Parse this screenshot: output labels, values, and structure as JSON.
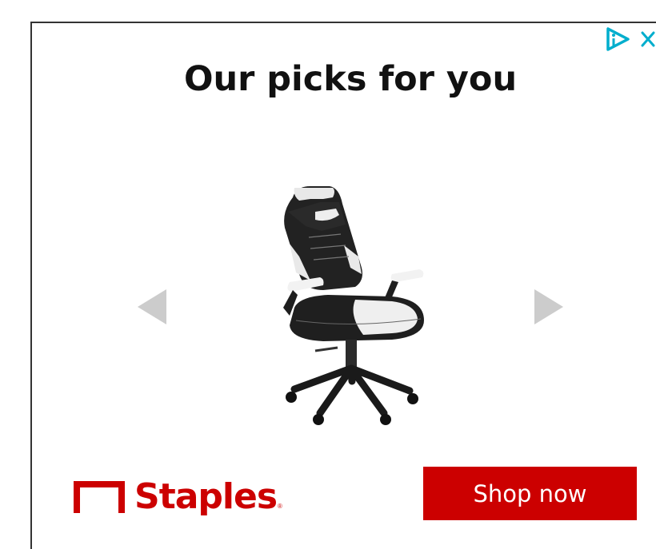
{
  "ad": {
    "title": "Our picks for you",
    "brand": "Staples",
    "brand_mark": "®",
    "cta_label": "Shop now",
    "product_image": "office-gaming-chair",
    "icons": {
      "adchoices": "adchoices-icon",
      "close": "close-icon",
      "prev": "arrow-left-icon",
      "next": "arrow-right-icon",
      "logo": "staples-logo-icon"
    },
    "colors": {
      "brand": "#cc0000",
      "arrow": "#cccccc",
      "adchoices": "#00aecd"
    }
  }
}
